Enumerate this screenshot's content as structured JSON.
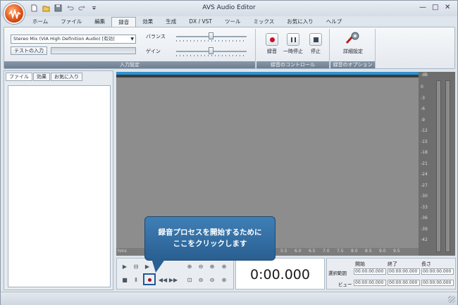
{
  "app": {
    "title": "AVS Audio Editor"
  },
  "quick_access": {
    "icons": [
      "new-file-icon",
      "open-folder-icon",
      "save-icon",
      "undo-icon",
      "redo-icon",
      "customize-icon"
    ]
  },
  "tabs": [
    "ホーム",
    "ファイル",
    "編集",
    "録音",
    "効果",
    "生成",
    "DX / VST",
    "ツール",
    "ミックス",
    "お気に入り",
    "ヘルプ"
  ],
  "active_tab": "録音",
  "ribbon": {
    "input": {
      "device": "Stereo Mix (VIA High Definition Audio) [有効]",
      "test_button": "テストの入力",
      "balance_label": "バランス",
      "gain_label": "ゲイン",
      "balance_value": 0.5,
      "gain_value": 0.5,
      "group_label": "入力設定"
    },
    "control": {
      "record": "録音",
      "pause": "一時停止",
      "stop": "停止",
      "group_label": "録音のコントロール"
    },
    "options": {
      "advanced": "詳細設定",
      "group_label": "録音のオプション"
    }
  },
  "left_panel": {
    "tabs": [
      "ファイル",
      "効果",
      "お気に入り"
    ]
  },
  "timeline": {
    "unit": "hms",
    "ticks": [
      "5.5",
      "6.0",
      "6.5",
      "7.0",
      "7.5",
      "8.0",
      "8.5",
      "9.0",
      "9.5"
    ]
  },
  "meter": {
    "unit": "dB",
    "ticks": [
      "0",
      "-3",
      "-6",
      "-9",
      "-12",
      "-15",
      "-18",
      "-21",
      "-24",
      "-27",
      "-30",
      "-33",
      "-36",
      "-39",
      "-42"
    ]
  },
  "time_display": "0:00.000",
  "selection": {
    "headers": [
      "開始",
      "終了",
      "長さ"
    ],
    "rows": [
      {
        "label": "選択範囲",
        "values": [
          "00:00:00.000",
          "00:00:00.000",
          "00:00:00.000"
        ]
      },
      {
        "label": "ビュー",
        "values": [
          "00:00:00.000",
          "00:00:00.000",
          "00:00:00.000"
        ]
      }
    ]
  },
  "callout": {
    "line1": "録音プロセスを開始するために",
    "line2": "ここをクリックします"
  },
  "colors": {
    "accent": "#2c93d3",
    "callout": "#2f6a9f",
    "record": "#c8102e"
  }
}
